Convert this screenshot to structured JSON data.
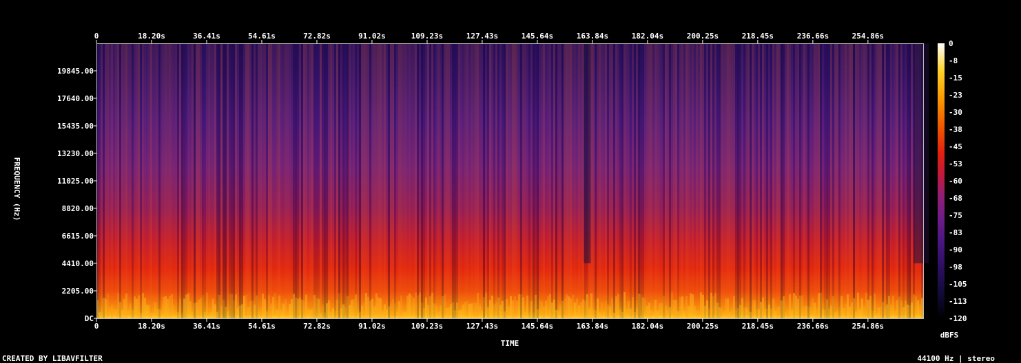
{
  "chart_data": {
    "type": "heatmap",
    "subtype": "spectrogram",
    "title": "",
    "xlabel": "TIME",
    "ylabel": "FREQUENCY (Hz)",
    "x_ticks": [
      "0",
      "18.20s",
      "36.41s",
      "54.61s",
      "72.82s",
      "91.02s",
      "109.23s",
      "127.43s",
      "145.64s",
      "163.84s",
      "182.04s",
      "200.25s",
      "218.45s",
      "236.66s",
      "254.86s"
    ],
    "x_tick_values": [
      0,
      18.2,
      36.41,
      54.61,
      72.82,
      91.02,
      109.23,
      127.43,
      145.64,
      163.84,
      182.04,
      200.25,
      218.45,
      236.66,
      254.86
    ],
    "xlim": [
      0,
      273.1
    ],
    "y_ticks": [
      "DC",
      "2205.00",
      "4410.00",
      "6615.00",
      "8820.00",
      "11025.00",
      "13230.00",
      "15435.00",
      "17640.00",
      "19845.00"
    ],
    "y_tick_values": [
      0,
      2205,
      4410,
      6615,
      8820,
      11025,
      13230,
      15435,
      17640,
      19845
    ],
    "ylim": [
      0,
      22050
    ],
    "colorbar": {
      "label": "dBFS",
      "ticks": [
        "0",
        "-8",
        "-15",
        "-23",
        "-30",
        "-38",
        "-45",
        "-53",
        "-60",
        "-68",
        "-75",
        "-83",
        "-90",
        "-98",
        "-105",
        "-113",
        "-120"
      ],
      "range": [
        -120,
        0
      ],
      "colors": [
        "#000000",
        "#1a0a4a",
        "#3b0f70",
        "#5a1c8a",
        "#7a2486",
        "#a8206f",
        "#d01e3c",
        "#e8280f",
        "#f36a00",
        "#fbb200",
        "#ffe860",
        "#ffffff"
      ]
    }
  },
  "footer": {
    "left": "CREATED BY LIBAVFILTER",
    "right": "44100 Hz | stereo"
  }
}
